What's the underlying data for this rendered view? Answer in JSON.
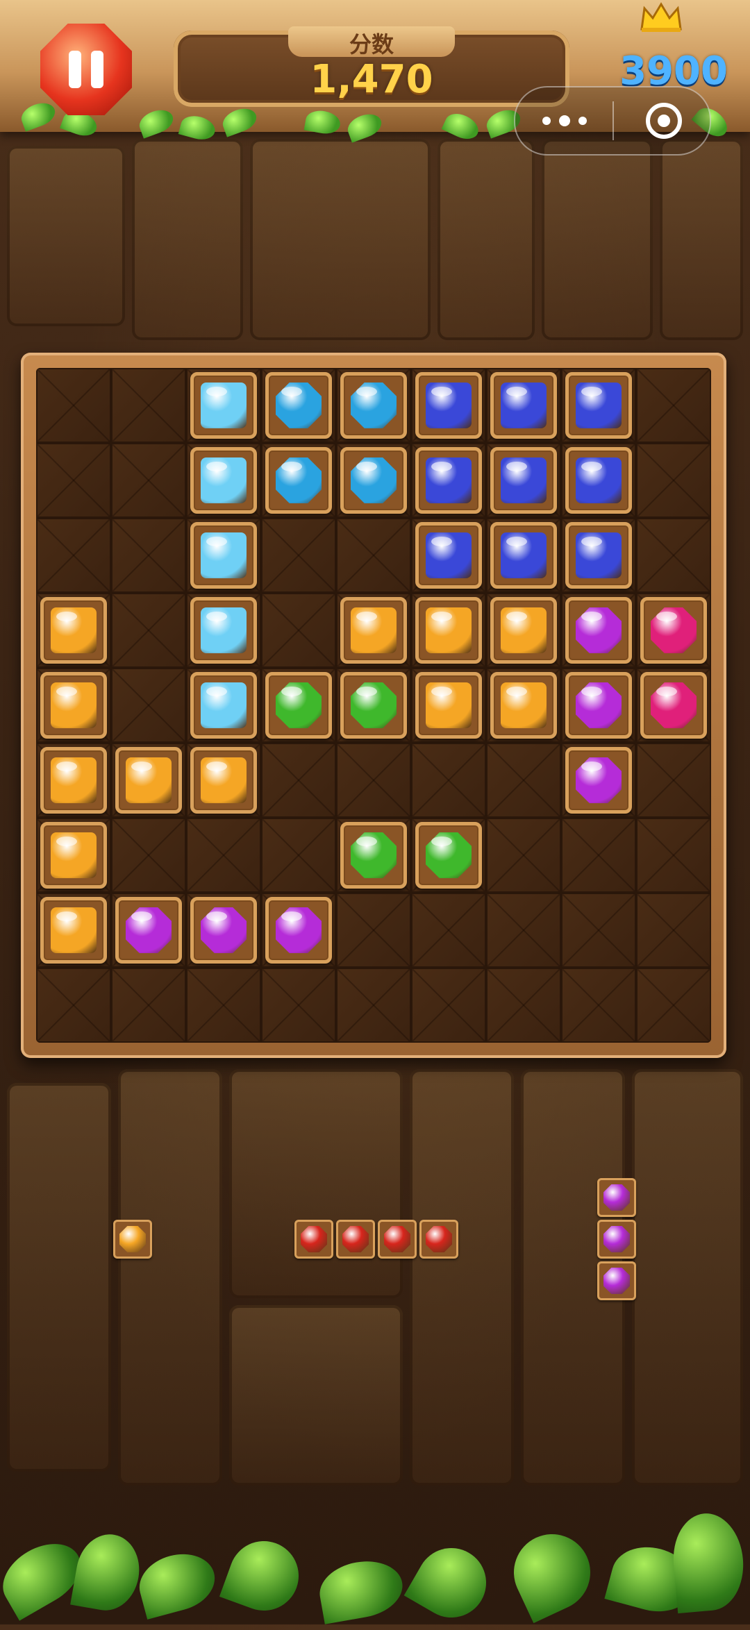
{
  "header": {
    "score_label": "分数",
    "score_value": "1,470",
    "best_score": "3900"
  },
  "icons": {
    "pause": "pause-icon",
    "crown": "crown-icon",
    "more": "more-dots-icon",
    "close": "close-target-icon"
  },
  "colors": {
    "cyan": "#6fd0f5",
    "blue": "#2aa3e0",
    "navy": "#3a48d8",
    "orange": "#f5a625",
    "green": "#3fb82c",
    "purple": "#b52cd8",
    "magenta": "#e0207a",
    "red": "#d7251c",
    "score_gold": "#ffd24a",
    "best_blue": "#4fb3ff"
  },
  "board": {
    "size": 9,
    "rows": [
      [
        "",
        "",
        "cyan",
        "blue",
        "blue",
        "navy",
        "navy",
        "navy",
        ""
      ],
      [
        "",
        "",
        "cyan",
        "blue",
        "blue",
        "navy",
        "navy",
        "navy",
        ""
      ],
      [
        "",
        "",
        "cyan",
        "",
        "",
        "navy",
        "navy",
        "navy",
        ""
      ],
      [
        "orange",
        "",
        "cyan",
        "",
        "orange",
        "orange",
        "orange",
        "purple",
        "magenta"
      ],
      [
        "orange",
        "",
        "cyan",
        "green",
        "green",
        "orange",
        "orange",
        "purple",
        "magenta"
      ],
      [
        "orange",
        "orange",
        "orange",
        "",
        "",
        "",
        "",
        "purple",
        ""
      ],
      [
        "orange",
        "",
        "",
        "",
        "green",
        "green",
        "",
        "",
        ""
      ],
      [
        "orange",
        "purple",
        "purple",
        "purple",
        "",
        "",
        "",
        "",
        ""
      ],
      [
        "",
        "",
        "",
        "",
        "",
        "",
        "",
        "",
        ""
      ]
    ]
  },
  "pieces": [
    {
      "color": "orange",
      "cells": [
        [
          0,
          0
        ]
      ]
    },
    {
      "color": "red",
      "cells": [
        [
          0,
          0
        ],
        [
          0,
          1
        ],
        [
          0,
          2
        ],
        [
          0,
          3
        ]
      ]
    },
    {
      "color": "purple",
      "cells": [
        [
          0,
          0
        ],
        [
          1,
          0
        ],
        [
          2,
          0
        ]
      ]
    }
  ]
}
